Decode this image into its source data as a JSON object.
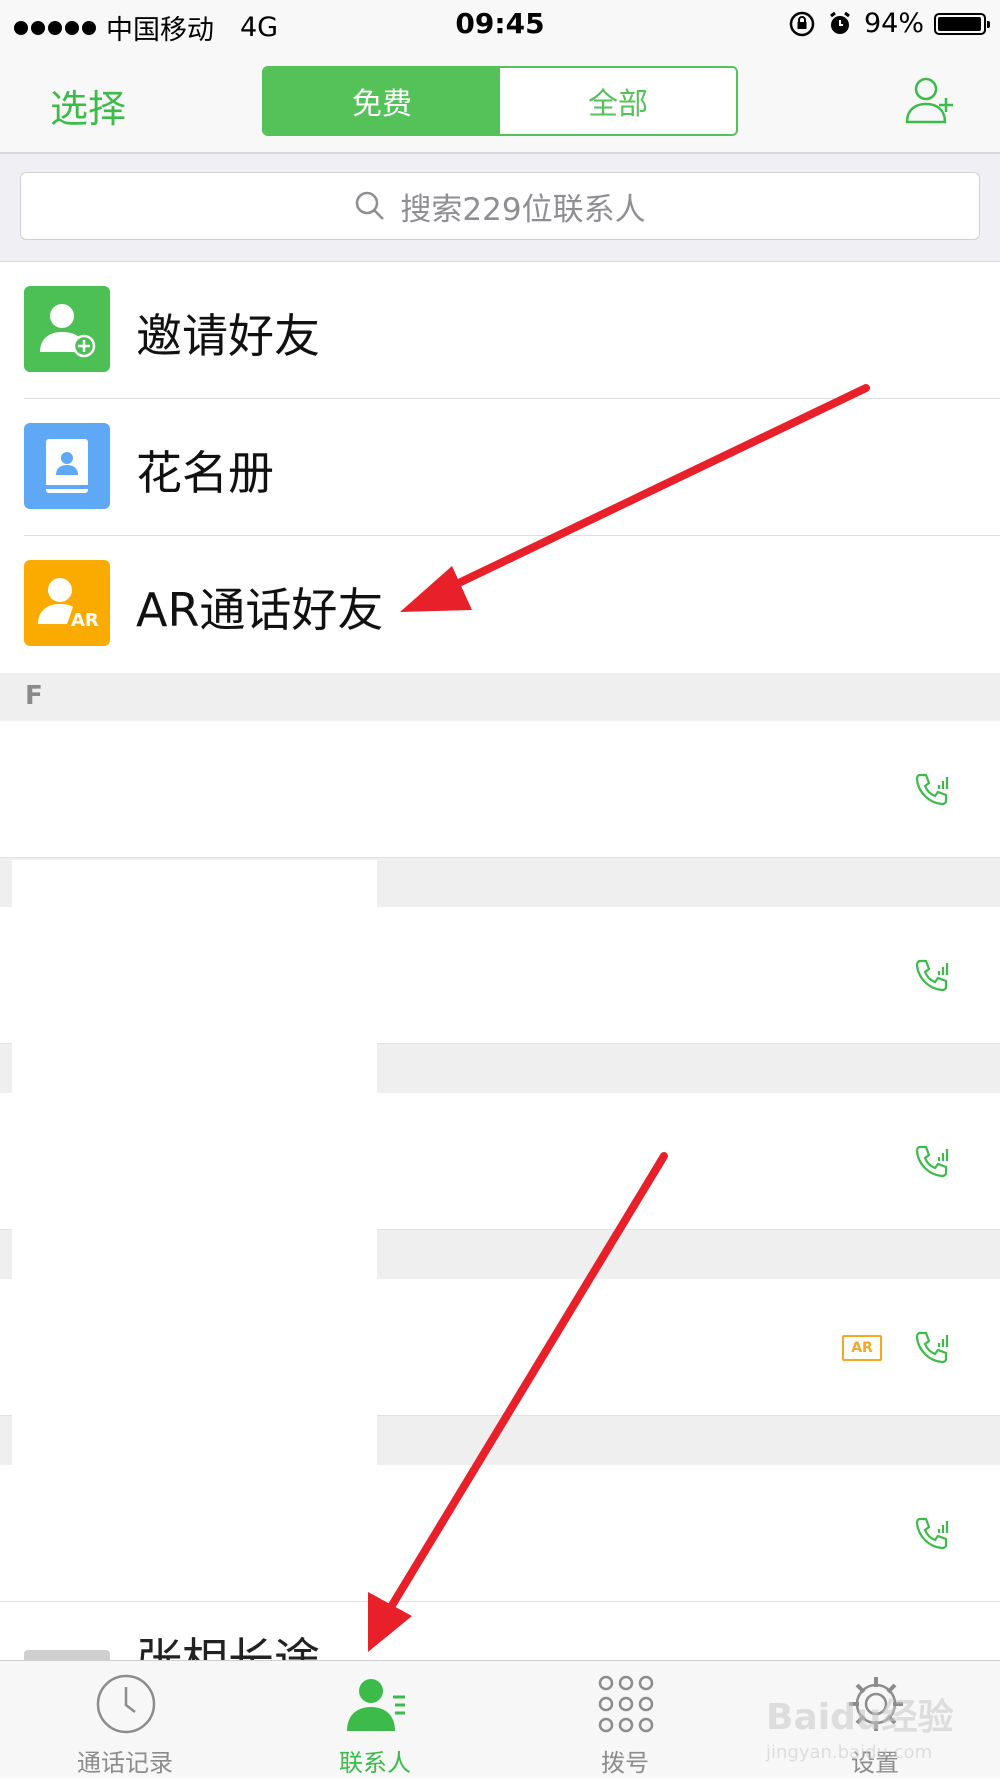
{
  "status_bar": {
    "carrier": "中国移动",
    "network": "4G",
    "time": "09:45",
    "battery": "94%"
  },
  "nav": {
    "select_label": "选择",
    "segments": [
      {
        "label": "免费",
        "active": true
      },
      {
        "label": "全部",
        "active": false
      }
    ],
    "add_contact_icon": "add-contact-icon"
  },
  "search": {
    "placeholder": "搜索229位联系人"
  },
  "features": [
    {
      "label": "邀请好友",
      "icon": "invite-friend-icon",
      "color": "#4cc054"
    },
    {
      "label": "花名册",
      "icon": "roster-book-icon",
      "color": "#5ea8f5"
    },
    {
      "label": "AR通话好友",
      "icon": "ar-friend-icon",
      "color": "#fbab00"
    }
  ],
  "section": {
    "letter": "F"
  },
  "contacts": {
    "ar_badge": "AR",
    "partial_name": "张相长途"
  },
  "tabs": [
    {
      "label": "通话记录",
      "icon": "clock-icon",
      "active": false
    },
    {
      "label": "联系人",
      "icon": "contacts-icon",
      "active": true
    },
    {
      "label": "拨号",
      "icon": "dialpad-icon",
      "active": false
    },
    {
      "label": "设置",
      "icon": "gear-icon",
      "active": false
    }
  ],
  "watermark": {
    "brand": "Baidu经验",
    "url": "jingyan.baidu.com"
  },
  "colors": {
    "accent_green": "#3dbb4a",
    "annotation_red": "#e8202a"
  }
}
